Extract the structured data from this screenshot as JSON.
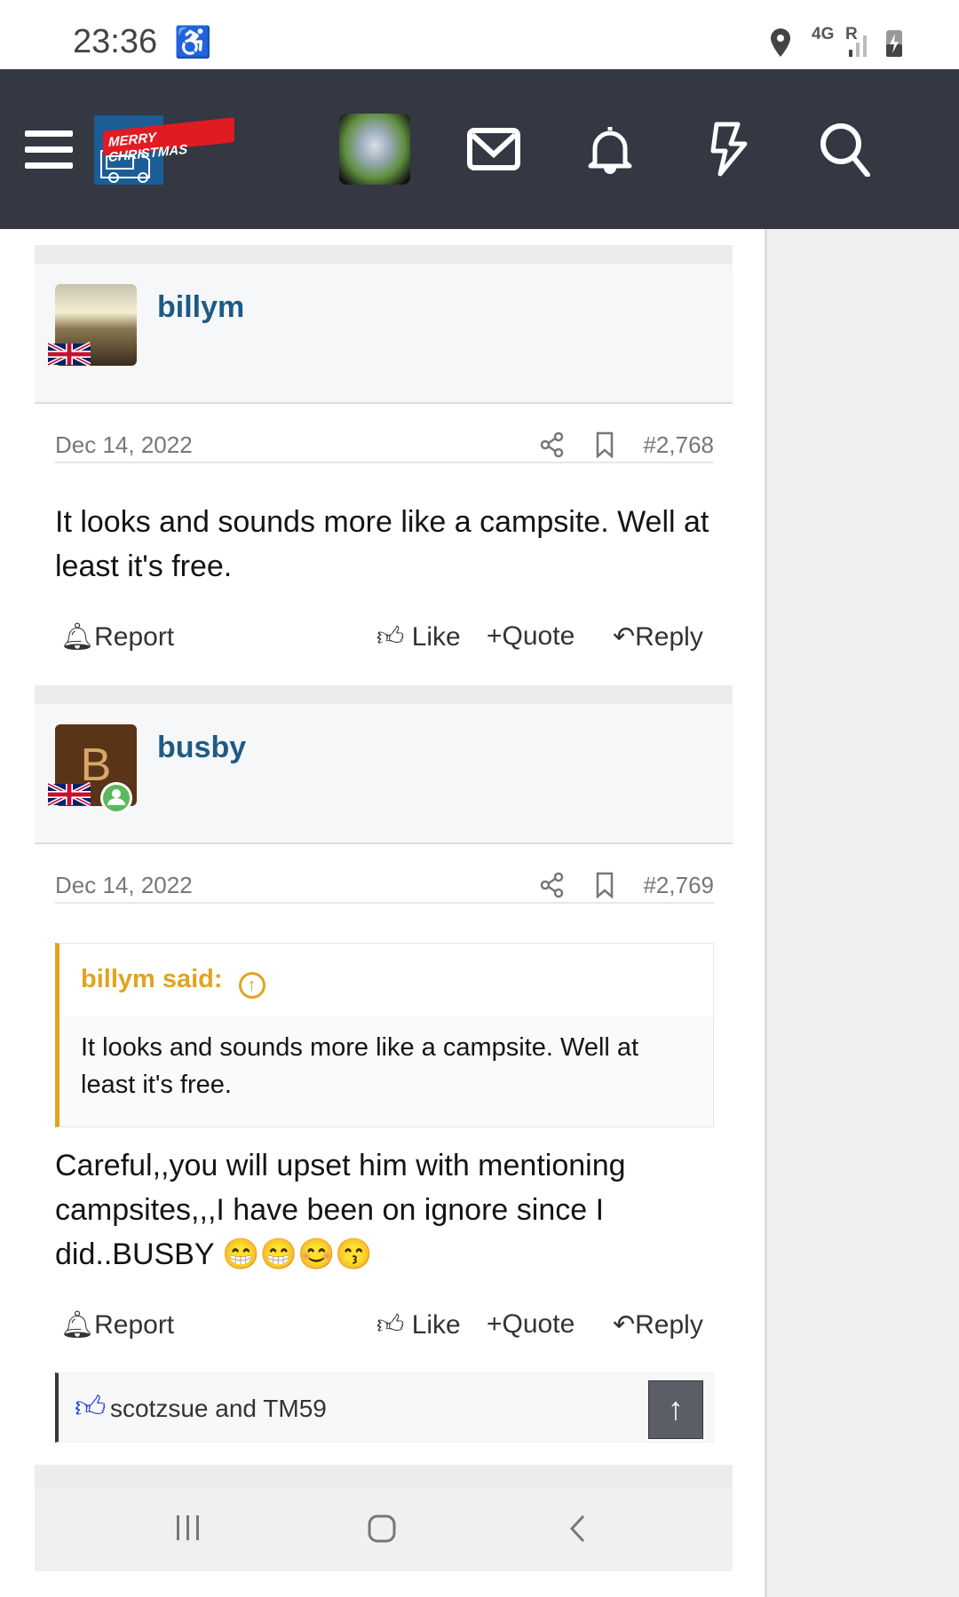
{
  "status": {
    "time": "23:36",
    "network": "4G",
    "roaming": "R"
  },
  "header": {
    "logo_text": "MERRY CHRISTMAS",
    "icons": [
      "menu-icon",
      "mail-icon",
      "bell-icon",
      "lightning-icon",
      "search-icon"
    ]
  },
  "posts": [
    {
      "author": "billym",
      "date": "Dec 14, 2022",
      "number": "#2,768",
      "body": "It looks and sounds more like a campsite. Well at least it's free.",
      "actions": {
        "report": "Report",
        "like": "Like",
        "quote": "Quote",
        "reply": "Reply"
      }
    },
    {
      "author": "busby",
      "avatar_letter": "B",
      "date": "Dec 14, 2022",
      "number": "#2,769",
      "quote": {
        "header": "billym said:",
        "text": "It looks and sounds more like a campsite. Well at least it's free."
      },
      "body": "Careful,,you will upset him with mentioning campsites,,,I have been on ignore since I did..BUSBY 😁😁😊😙",
      "actions": {
        "report": "Report",
        "like": "Like",
        "quote": "Quote",
        "reply": "Reply"
      },
      "likes": "scotzsue and TM59"
    }
  ],
  "colors": {
    "header_bg": "#333842",
    "username": "#1d5b85",
    "quote_accent": "#e0a420",
    "like_blue": "#1a3fd0"
  }
}
